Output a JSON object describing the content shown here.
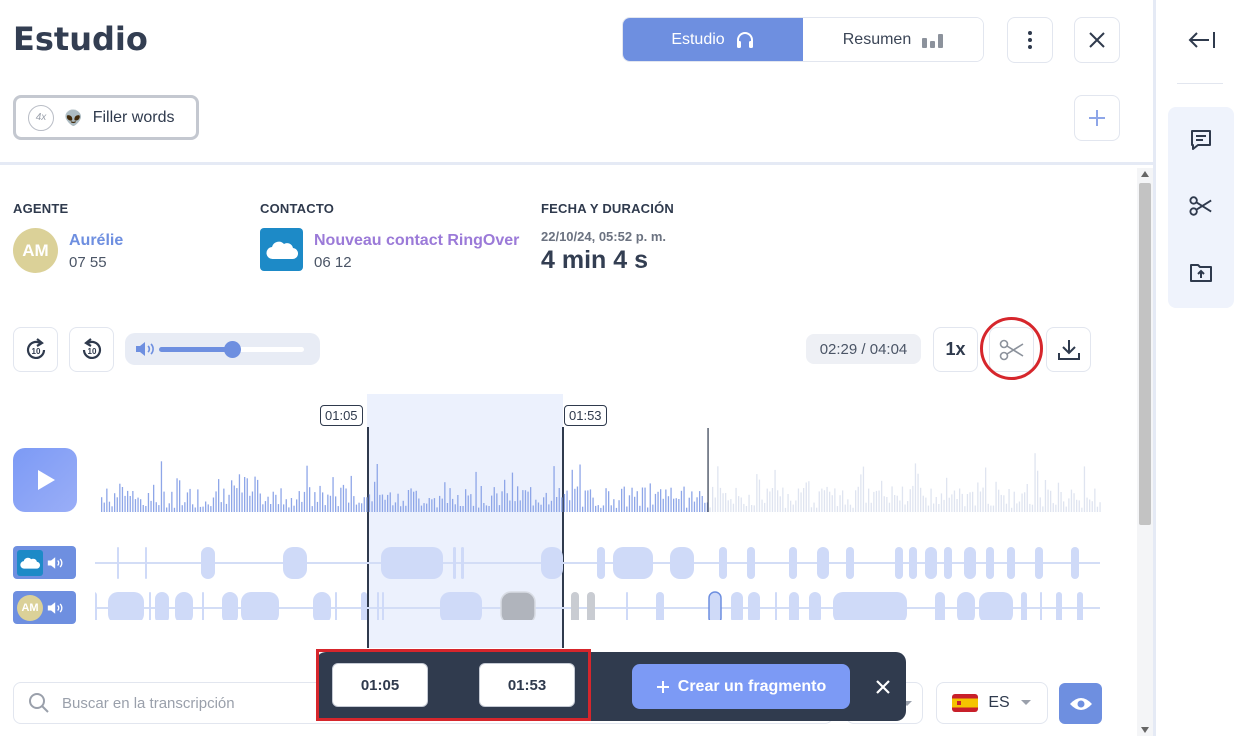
{
  "header": {
    "title": "Estudio",
    "tabs": [
      {
        "label": "Estudio",
        "active": true,
        "icon": "headphones-icon"
      },
      {
        "label": "Resumen",
        "active": false,
        "icon": "bar-chart-icon"
      }
    ]
  },
  "filter_chip": {
    "count": "4x",
    "emoji": "👽",
    "label": "Filler words"
  },
  "agent": {
    "heading": "AGENTE",
    "initials": "AM",
    "name": "Aurélie",
    "number": "07 55"
  },
  "contact": {
    "heading": "CONTACTO",
    "name": "Nouveau contact RingOver",
    "number": "06 12"
  },
  "date": {
    "heading": "FECHA Y DURACIÓN",
    "datetime": "22/10/24, 05:52 p. m.",
    "duration": "4 min 4 s"
  },
  "player": {
    "skip_forward_label": "10",
    "skip_back_label": "10",
    "volume": 0.5,
    "time": "02:29 / 04:04",
    "speed": "1x",
    "progress": 0.61
  },
  "selection": {
    "start": "01:05",
    "end": "01:53"
  },
  "tracks": {
    "agent_initials": "AM"
  },
  "cut_bar": {
    "start": "01:05",
    "end": "01:53",
    "create_label": "Crear un fragmento"
  },
  "search": {
    "placeholder": "Buscar en la transcripción"
  },
  "language": {
    "code": "ES"
  },
  "colors": {
    "accent": "#6e8fe0",
    "contact_link": "#9b7ad8",
    "agent_link": "#6e8fe0",
    "highlight": "#d6262c",
    "dark_bar": "#303b4e"
  }
}
